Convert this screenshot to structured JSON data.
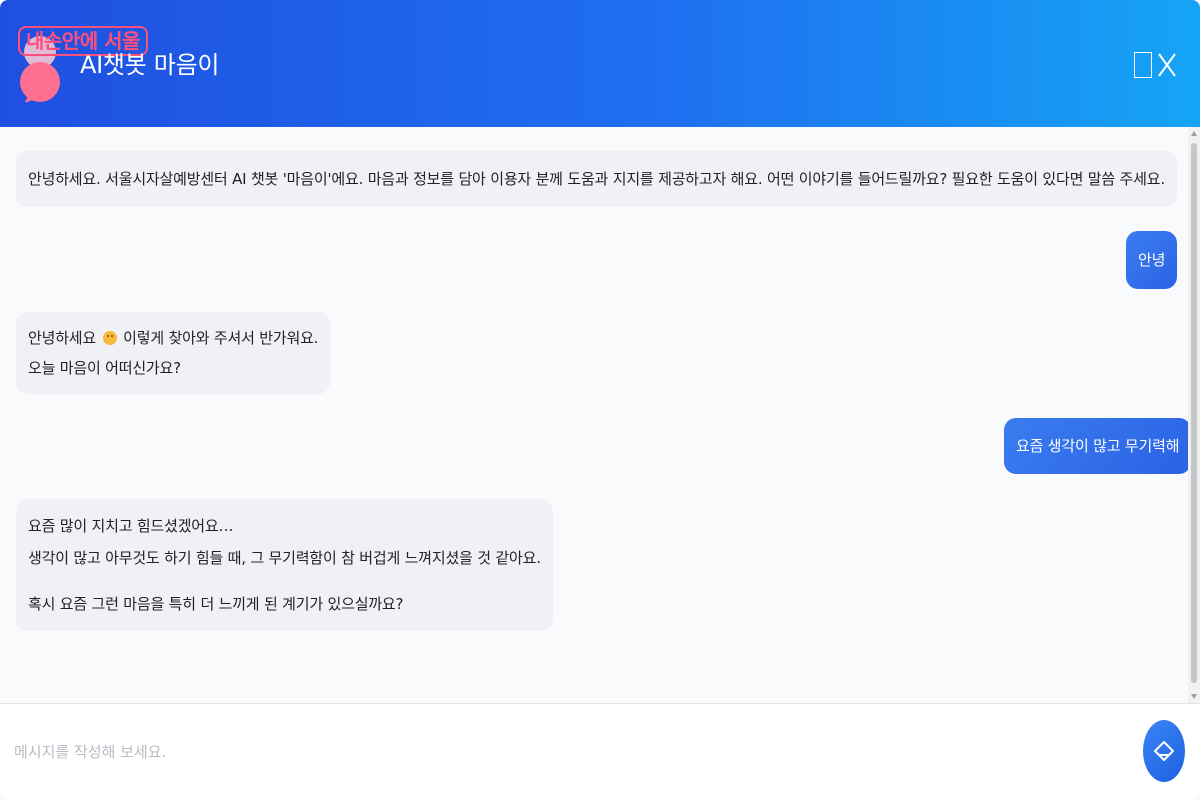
{
  "header": {
    "logo_text": "내손안에 서울",
    "title": "AI챗봇 마음이",
    "controls": {
      "minimize_icon": "square-icon",
      "close_icon": "close-icon"
    }
  },
  "messages": [
    {
      "sender": "bot",
      "lines": [
        "안녕하세요. 서울시자살예방센터 AI 챗봇 '마음이'에요. 마음과 정보를 담아 이용자 분께 도움과 지지를 제공하고자 해요. 어떤 이야기를 들어드릴까요? 필요한 도움이 있다면 말씀 주세요."
      ]
    },
    {
      "sender": "user",
      "text": "안녕"
    },
    {
      "sender": "bot",
      "line1_before": "안녕하세요",
      "line1_emoji": "smiling-face-emoji",
      "line1_after": "이렇게 찾아와 주셔서 반가워요.",
      "line2": "오늘 마음이 어떠신가요?"
    },
    {
      "sender": "user",
      "text": "요즘 생각이 많고 무기력해"
    },
    {
      "sender": "bot",
      "lines": [
        "요즘 많이 지치고 힘드셨겠어요…",
        "생각이 많고 아무것도 하기 힘들 때, 그 무기력함이 참 버겁게 느껴지셨을 것 같아요.",
        "",
        "혹시 요즘 그런 마음을 특히 더 느끼게 된 계기가 있으실까요?"
      ]
    }
  ],
  "input": {
    "placeholder": "메시지를 작성해 보세요.",
    "value": ""
  },
  "send_button": {
    "icon": "send-icon"
  },
  "colors": {
    "header_gradient_start": "#1f4fe0",
    "header_gradient_end": "#15a4f5",
    "logo_accent": "#ff4f7a",
    "bot_bubble": "#eff1f6",
    "user_bubble": "#3b7cf0"
  }
}
